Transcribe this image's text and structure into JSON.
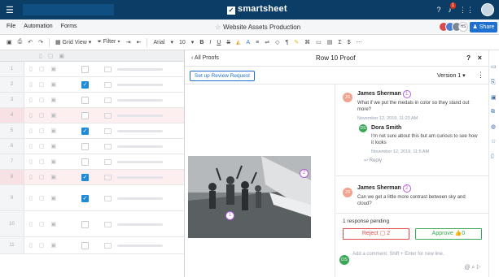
{
  "brand": "smartsheet",
  "topbar": {
    "notifications": "1",
    "icons": [
      "help-icon",
      "bell-icon",
      "apps-icon"
    ]
  },
  "menu": {
    "items": [
      "File",
      "Automation",
      "Forms"
    ],
    "sheet_title": "Website Assets Production",
    "share": "Share",
    "collaborator_initials": "HS"
  },
  "toolbar": {
    "view": "Grid View",
    "filter": "Filter",
    "font": "Arial",
    "size": "10",
    "tools": [
      "B",
      "I",
      "U",
      "S",
      "Σ",
      "$"
    ]
  },
  "grid": {
    "rows": [
      {
        "n": "1",
        "checked": false,
        "pink": false
      },
      {
        "n": "2",
        "checked": true,
        "pink": false
      },
      {
        "n": "3",
        "checked": false,
        "pink": false
      },
      {
        "n": "4",
        "checked": false,
        "pink": true
      },
      {
        "n": "5",
        "checked": true,
        "pink": false
      },
      {
        "n": "6",
        "checked": false,
        "pink": false
      },
      {
        "n": "7",
        "checked": false,
        "pink": false
      },
      {
        "n": "8",
        "checked": true,
        "pink": true
      },
      {
        "n": "9",
        "checked": true,
        "pink": false
      },
      {
        "n": "10",
        "checked": false,
        "pink": false
      },
      {
        "n": "11",
        "checked": false,
        "pink": false
      }
    ]
  },
  "panel": {
    "back": "All Proofs",
    "title": "Row 10 Proof",
    "request_btn": "Set up Review Request",
    "version": "Version 1"
  },
  "pins": [
    "1",
    "2"
  ],
  "comments": [
    {
      "initials": "JS",
      "name": "James Sherman",
      "pin": "1",
      "text": "What if we put the medals in color so they stand out more?",
      "date": "November 12, 2019, 11:23 AM",
      "color": "#f0a38f"
    },
    {
      "initials": "DS",
      "name": "Dora Smith",
      "text": "I'm not sure about this but am curious to see how it looks",
      "date": "November 12, 2019, 11:5 AM",
      "color": "#3aa757"
    },
    {
      "initials": "JS",
      "name": "James Sherman",
      "pin": "2",
      "text": "Can we get a little more contrast between sky and cloud?",
      "color": "#f0a38f"
    }
  ],
  "reply_label": "Reply",
  "pending": "1 response pending",
  "reject": "Reject",
  "reject_count": "2",
  "approve": "Approve",
  "approve_count": "0",
  "compose": {
    "initials": "DS",
    "placeholder": "Add a comment. Shift + Enter for new line."
  }
}
